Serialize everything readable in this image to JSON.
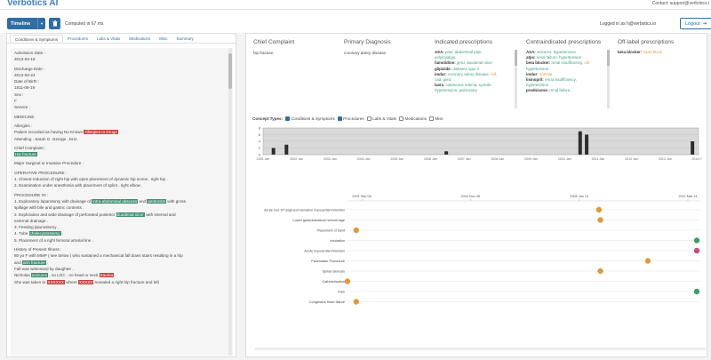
{
  "app": {
    "title": "Verbotics AI",
    "contact": "Contact: support@verbotics.i"
  },
  "toolbar": {
    "timeline_label": "Timeline",
    "computed": "Computed in 67 ms",
    "logged_in": "Logged in as h@verbotics.io",
    "logout_label": "Logout"
  },
  "tabs": [
    "Conditions & Symptoms",
    "Procedures",
    "Labs & Vitals",
    "Medications",
    "Misc",
    "Summary"
  ],
  "note": [
    {
      "text": "Admission Date :"
    },
    {
      "text": "2013-03-18"
    },
    {
      "sp": true
    },
    {
      "text": "Discharge Date :"
    },
    {
      "text": "2013-03-24"
    },
    {
      "text": "Date of Birth :"
    },
    {
      "text": "1811-08-19"
    },
    {
      "text": "Sex :"
    },
    {
      "text": "F"
    },
    {
      "text": "Service :"
    },
    {
      "sp": true
    },
    {
      "text": "MEDICINE"
    },
    {
      "sp": true
    },
    {
      "text": "Allergies :"
    },
    {
      "parts": [
        {
          "t": "Patient recorded as having No Known "
        },
        {
          "t": "Allergies to Drugs",
          "h": "r"
        }
      ]
    },
    {
      "text": "Attending : Sarah G. George , M.D."
    },
    {
      "sp": true
    },
    {
      "text": "Chief Complaint :"
    },
    {
      "parts": [
        {
          "t": "Hip fracture",
          "h": "g"
        }
      ]
    },
    {
      "sp": true
    },
    {
      "text": "Major Surgical or Invasive Procedure :"
    },
    {
      "sp": true
    },
    {
      "text": "OPERATIVE PROCEDURE :"
    },
    {
      "text": "1. Closed reduction of right hip with open placement of dynamic hip screw , right hip ."
    },
    {
      "text": "2. Examination under anesthesia with placement of splint , right elbow ."
    },
    {
      "sp": true
    },
    {
      "text": "PROCEDURE #2 :"
    },
    {
      "parts": [
        {
          "t": "1. Exploratory laparotomy with drainage of "
        },
        {
          "t": "intra-abdominal abscess",
          "h": "g"
        },
        {
          "t": " and "
        },
        {
          "t": "peritonitis",
          "h": "g"
        },
        {
          "t": " with gross"
        }
      ]
    },
    {
      "text": "spillage with bile and gastric contents ."
    },
    {
      "parts": [
        {
          "t": "2. Exploration and wide drainage of perforated posterior "
        },
        {
          "t": "duodenal ulcer",
          "h": "g"
        },
        {
          "t": " with internal and"
        }
      ]
    },
    {
      "text": "external drainage ."
    },
    {
      "text": "3. Feeding jejunostomy ."
    },
    {
      "parts": [
        {
          "t": "4. Tube "
        },
        {
          "t": "cholecystostomy",
          "h": "g"
        },
        {
          "t": " ."
        }
      ]
    },
    {
      "text": "5. Placement of a right femoral arterial line ."
    },
    {
      "sp": true
    },
    {
      "text": "History of Present Illness :"
    },
    {
      "text": "80 yo F with MMP ( see below ) who sustained a mechanical fall down stairs resulting in a hip"
    },
    {
      "parts": [
        {
          "t": "and "
        },
        {
          "t": "arm fracture",
          "h": "g"
        },
        {
          "t": " ."
        }
      ]
    },
    {
      "text": "Fall was witnessed by daughter ."
    },
    {
      "parts": [
        {
          "t": "Nicholas "
        },
        {
          "t": "seizures",
          "h": "g"
        },
        {
          "t": " , no LOC , no head or neck "
        },
        {
          "t": "trauma",
          "h": "r"
        },
        {
          "t": " ."
        }
      ]
    },
    {
      "parts": [
        {
          "t": "She was taken to "
        },
        {
          "t": "XXXXXX",
          "h": "r"
        },
        {
          "t": " where "
        },
        {
          "t": "XXXXX",
          "h": "r"
        },
        {
          "t": " revealed a right hip fracture and left"
        }
      ]
    }
  ],
  "summary": {
    "chief_complaint_title": "Chief Complaint",
    "chief_complaint": "hip fracture",
    "primary_dx_title": "Primary Diagnosis",
    "primary_dx": "coronary artery disease",
    "indicated_title": "Indicated prescriptions",
    "indicated": [
      {
        "drug": "ASA:",
        "items": [
          {
            "t": " pain, abdominal pain,",
            "c": "gr"
          }
        ]
      },
      {
        "drug": "",
        "items": [
          {
            "t": "polymyalgia",
            "c": "gr"
          }
        ]
      },
      {
        "drug": "famotidine:",
        "items": [
          {
            "t": " gerd, duodenal ulcer",
            "c": "gr"
          }
        ]
      },
      {
        "drug": "glipizide:",
        "items": [
          {
            "t": " diabetes type 2",
            "c": "gr"
          }
        ]
      },
      {
        "drug": "imdur:",
        "items": [
          {
            "t": " coronary artery disease, ",
            "c": "gr"
          },
          {
            "t": "chf,",
            "c": "or"
          }
        ]
      },
      {
        "drug": "",
        "items": [
          {
            "t": "cad, gerd",
            "c": "gr"
          }
        ]
      },
      {
        "drug": "lasix:",
        "items": [
          {
            "t": " cutaneous edema, systolic",
            "c": "gr"
          }
        ]
      },
      {
        "drug": "",
        "items": [
          {
            "t": "hypertension, pulmonary",
            "c": "gr"
          }
        ]
      }
    ],
    "contra_title": "Contraindicated prescriptions",
    "contra": [
      {
        "drug": "ASA:",
        "items": [
          {
            "t": " seizures, hypertension",
            "c": "gr"
          }
        ]
      },
      {
        "drug": "atpx:",
        "items": [
          {
            "t": " renal failure, hypertension",
            "c": "gr"
          }
        ]
      },
      {
        "drug": "beta blocker:",
        "items": [
          {
            "t": " renal insufficiency, ",
            "c": "gr"
          },
          {
            "t": "chf,",
            "c": "or"
          }
        ]
      },
      {
        "drug": "",
        "items": [
          {
            "t": "hypertension",
            "c": "gr"
          }
        ]
      },
      {
        "drug": "imdur:",
        "items": [
          {
            "t": " anemia",
            "c": "or"
          }
        ]
      },
      {
        "drug": "lisinopril:",
        "items": [
          {
            "t": " renal insufficiency,",
            "c": "gr"
          }
        ]
      },
      {
        "drug": "",
        "items": [
          {
            "t": "hypertension",
            "c": "gr"
          }
        ]
      },
      {
        "drug": "prednisone:",
        "items": [
          {
            "t": " renal failure,",
            "c": "gr"
          }
        ]
      }
    ],
    "offlabel_title": "Off-label prescriptions",
    "offlabel": [
      {
        "drug": "beta blocker:",
        "items": [
          {
            "t": " heart block",
            "c": "or"
          }
        ]
      }
    ]
  },
  "concept_types": {
    "label": "Concept Types:",
    "items": [
      {
        "label": "Conditions & Symptoms",
        "checked": true
      },
      {
        "label": "Procedures",
        "checked": true
      },
      {
        "label": "Labs & Vitals",
        "checked": false
      },
      {
        "label": "Medications",
        "checked": false
      },
      {
        "label": "Misc",
        "checked": false
      }
    ]
  },
  "chart_data": {
    "type": "scatter",
    "overview": {
      "y_ticks": [
        "8",
        "6",
        "4",
        "2",
        "0"
      ],
      "x_ticks": [
        "2001 Jan",
        "2002 Jan",
        "2003 Jan",
        "2004 Jan",
        "2005 Jan",
        "2006 Jan",
        "2007 Jan",
        "2008 Jan",
        "2009 Jan",
        "2010 Jan",
        "2011 Jan",
        "2012 Jan",
        "2013 Jan",
        "2014 Feb"
      ],
      "bars": [
        {
          "x": 0.02,
          "h": 2
        },
        {
          "x": 0.05,
          "h": 3
        },
        {
          "x": 0.42,
          "h": 1
        },
        {
          "x": 0.73,
          "h": 7
        },
        {
          "x": 0.745,
          "h": 6
        },
        {
          "x": 0.99,
          "h": 4
        }
      ],
      "brush": [
        0.0,
        1.0
      ]
    },
    "detail": {
      "x_ticks": [
        "2001 Sep 08",
        "2004 Nov 08",
        "2008 Jan 13",
        "2011 Mar 14"
      ],
      "rows": [
        {
          "label": "Acute non-ST segment elevation myocardial infarction",
          "x": 0.72,
          "color": "#e09a3e"
        },
        {
          "label": "Lower gastrointestinal hemorrhage",
          "x": 0.724,
          "color": "#e09a3e"
        },
        {
          "label": "Placement of stent",
          "x": 0.025,
          "color": "#e09a3e"
        },
        {
          "label": "Intubation",
          "x": 1.0,
          "color": "#3e9e64"
        },
        {
          "label": "Acute myocardial infarction",
          "x": 1.0,
          "color": "#c94a7a"
        },
        {
          "label": "Pacemaker Procedure",
          "x": 0.86,
          "color": "#e09a3e"
        },
        {
          "label": "Spinal stenosis",
          "x": 0.724,
          "color": "#e09a3e"
        },
        {
          "label": "Catheterization",
          "x": 0.0,
          "color": "#e09a3e"
        },
        {
          "label": "Pain",
          "x": 1.0,
          "color": "#3e9e64"
        },
        {
          "label": "Congestive heart failure",
          "x": 0.025,
          "color": "#e09a3e"
        }
      ]
    }
  },
  "colors": {
    "primary": "#2f6ea5",
    "highlight_green": "#3e8e6f",
    "highlight_red": "#c9413e"
  }
}
